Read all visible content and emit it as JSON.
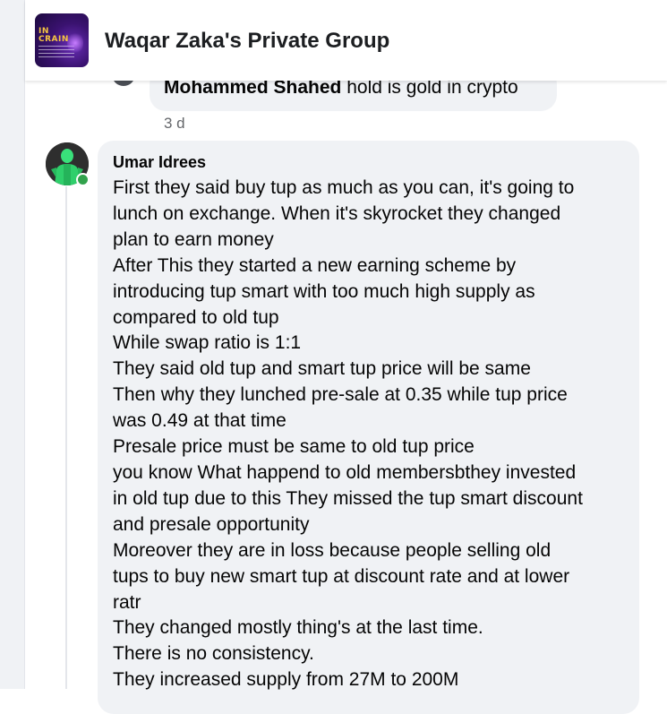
{
  "group": {
    "title": "Waqar Zaka's Private Group",
    "logo_text": "IN\nCRAIN"
  },
  "previous_comment": {
    "author": "Mohammed Shahed",
    "text": "hold is gold in crypto",
    "time": "3 d"
  },
  "comment": {
    "author": "Umar Idrees",
    "lines": [
      "First they said buy tup as much as you can, it's going to",
      "lunch on exchange. When it's skyrocket they changed",
      "plan to earn money",
      "After This they started a new earning scheme by",
      "introducing tup smart with too much high supply as",
      "compared to old tup",
      "While swap ratio is 1:1",
      "They said old tup and smart tup price will be same",
      "Then why they lunched pre-sale at 0.35 while tup price",
      "was 0.49 at that time",
      "Presale price must be same to old tup price",
      "you know What happend to old membersbthey invested",
      "in old tup due to this They missed the tup smart discount",
      "and presale opportunity",
      "Moreover they are in loss because people selling old",
      "tups to buy new smart tup at discount rate and at lower",
      "ratr",
      "They changed mostly thing's at the last time.",
      "There is no consistency.",
      "They increased supply from 27M to 200M"
    ]
  },
  "colors": {
    "bubble": "#f0f2f5",
    "online": "#31a24c",
    "meta": "#65676b"
  }
}
